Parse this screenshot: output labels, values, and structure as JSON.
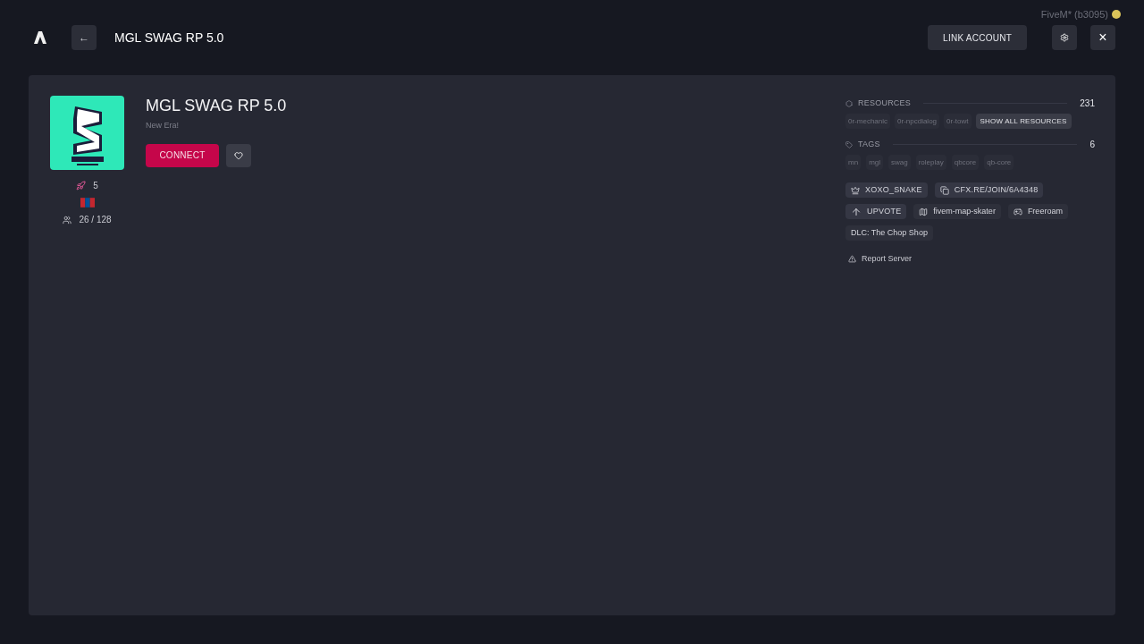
{
  "build_label": "FiveM* (b3095)",
  "header": {
    "back": "←",
    "title": "MGL SWAG RP 5.0",
    "link_account": "LINK ACCOUNT",
    "close": "×"
  },
  "server": {
    "name": "MGL SWAG RP 5.0",
    "description": "New Era!",
    "connect": "CONNECT",
    "favorite": false,
    "boost": "5",
    "players": "26 / 128"
  },
  "resources": {
    "label": "RESOURCES",
    "count": "231",
    "items": [
      "0r-mechanic",
      "0r-npcdialog",
      "0r-towt"
    ],
    "show_all": "SHOW ALL RESOURCES"
  },
  "tags": {
    "label": "TAGS",
    "count": "6",
    "items": [
      "mn",
      "mgl",
      "swag",
      "roleplay",
      "qbcore",
      "qb-core"
    ]
  },
  "chips": [
    {
      "kind": "owner",
      "text": "XOXO_SNAKE"
    },
    {
      "kind": "join",
      "text": "CFX.RE/JOIN/6A4348"
    },
    {
      "kind": "upvote",
      "text": "UPVOTE"
    },
    {
      "kind": "map",
      "text": "fivem-map-skater"
    },
    {
      "kind": "gametype",
      "text": "Freeroam"
    },
    {
      "kind": "plain",
      "text": "DLC: The Chop Shop"
    }
  ],
  "report": "Report Server"
}
